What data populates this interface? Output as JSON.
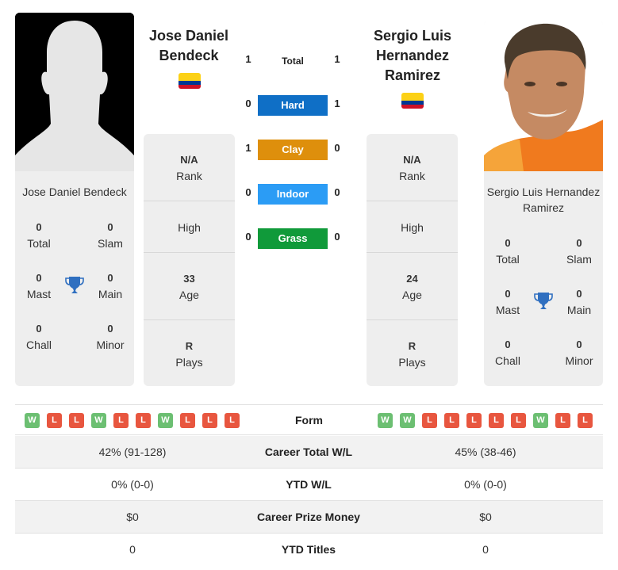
{
  "player1": {
    "name": "Jose Daniel Bendeck",
    "name_heading_line1": "Jose Daniel",
    "name_heading_line2": "Bendeck",
    "country": "Colombia",
    "photo": "silhouette-placeholder",
    "titles": {
      "total": {
        "value": "0",
        "label": "Total"
      },
      "slam": {
        "value": "0",
        "label": "Slam"
      },
      "mast": {
        "value": "0",
        "label": "Mast"
      },
      "main": {
        "value": "0",
        "label": "Main"
      },
      "chall": {
        "value": "0",
        "label": "Chall"
      },
      "minor": {
        "value": "0",
        "label": "Minor"
      }
    },
    "info": {
      "rank": {
        "value": "N/A",
        "label": "Rank"
      },
      "high": {
        "value": "",
        "label": "High"
      },
      "age": {
        "value": "33",
        "label": "Age"
      },
      "plays": {
        "value": "R",
        "label": "Plays"
      }
    },
    "form": [
      "W",
      "L",
      "L",
      "W",
      "L",
      "L",
      "W",
      "L",
      "L",
      "L"
    ]
  },
  "player2": {
    "name_line1": "Sergio Luis Hernandez",
    "name_line2": "Ramirez",
    "name_heading_line1": "Sergio Luis",
    "name_heading_line2": "Hernandez",
    "name_heading_line3": "Ramirez",
    "country": "Colombia",
    "photo": "player-photo",
    "titles": {
      "total": {
        "value": "0",
        "label": "Total"
      },
      "slam": {
        "value": "0",
        "label": "Slam"
      },
      "mast": {
        "value": "0",
        "label": "Mast"
      },
      "main": {
        "value": "0",
        "label": "Main"
      },
      "chall": {
        "value": "0",
        "label": "Chall"
      },
      "minor": {
        "value": "0",
        "label": "Minor"
      }
    },
    "info": {
      "rank": {
        "value": "N/A",
        "label": "Rank"
      },
      "high": {
        "value": "",
        "label": "High"
      },
      "age": {
        "value": "24",
        "label": "Age"
      },
      "plays": {
        "value": "R",
        "label": "Plays"
      }
    },
    "form": [
      "W",
      "W",
      "L",
      "L",
      "L",
      "L",
      "L",
      "W",
      "L",
      "L"
    ]
  },
  "h2h": {
    "total": {
      "label": "Total",
      "p1": "1",
      "p2": "1"
    },
    "surfaces": [
      {
        "label": "Hard",
        "p1": "0",
        "p2": "1",
        "color": "#0f6fc6"
      },
      {
        "label": "Clay",
        "p1": "1",
        "p2": "0",
        "color": "#de8f0c"
      },
      {
        "label": "Indoor",
        "p1": "0",
        "p2": "0",
        "color": "#2b9cf5"
      },
      {
        "label": "Grass",
        "p1": "0",
        "p2": "0",
        "color": "#109a3a"
      }
    ]
  },
  "form_label": "Form",
  "stats": [
    {
      "label": "Career Total W/L",
      "p1": "42% (91-128)",
      "p2": "45% (38-46)"
    },
    {
      "label": "YTD W/L",
      "p1": "0% (0-0)",
      "p2": "0% (0-0)"
    },
    {
      "label": "Career Prize Money",
      "p1": "$0",
      "p2": "$0"
    },
    {
      "label": "YTD Titles",
      "p1": "0",
      "p2": "0"
    }
  ]
}
